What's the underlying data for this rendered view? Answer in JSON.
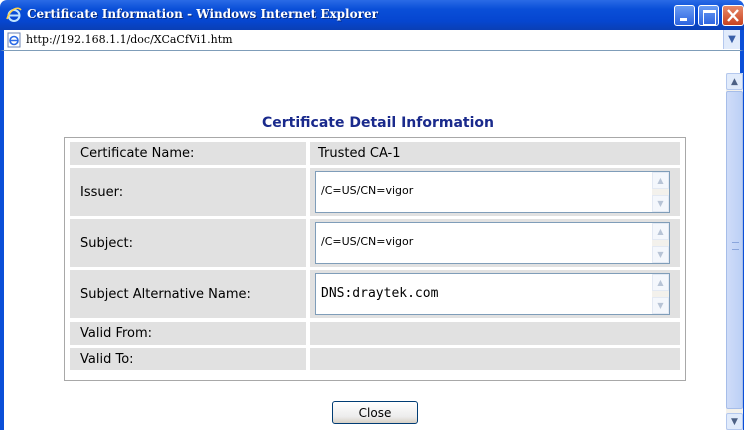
{
  "window": {
    "title": "Certificate Information - Windows Internet Explorer",
    "address": "http://192.168.1.1/doc/XCaCfVi1.htm"
  },
  "page": {
    "heading": "Certificate Detail Information",
    "rows": [
      {
        "label": "Certificate Name:",
        "value": "Trusted CA-1"
      },
      {
        "label": "Issuer:",
        "value": "/C=US/CN=vigor"
      },
      {
        "label": "Subject:",
        "value": "/C=US/CN=vigor"
      },
      {
        "label": "Subject Alternative Name:",
        "value": "DNS:draytek.com"
      },
      {
        "label": "Valid From:",
        "value": ""
      },
      {
        "label": "Valid To:",
        "value": ""
      }
    ],
    "close_label": "Close"
  },
  "colors": {
    "titlebar": "#0a4fd8",
    "heading": "#1a2a8c",
    "cell_background": "#e1e1e1"
  }
}
